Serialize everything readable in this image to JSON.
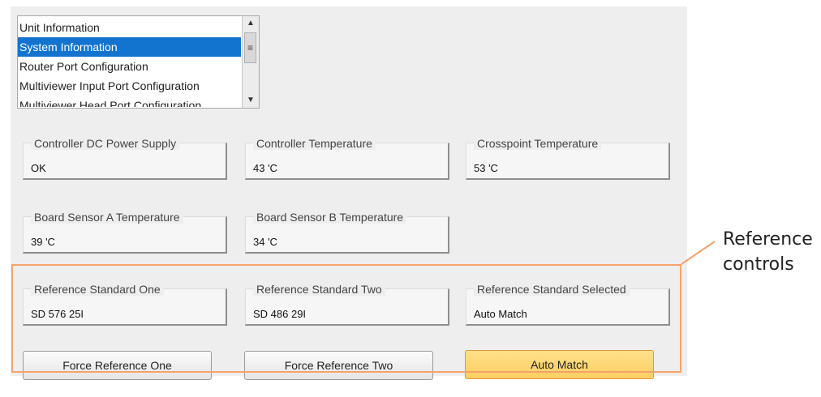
{
  "list": {
    "items": [
      {
        "label": "Unit Information",
        "selected": false
      },
      {
        "label": "System Information",
        "selected": true
      },
      {
        "label": "Router Port Configuration",
        "selected": false
      },
      {
        "label": "Multiviewer Input Port Configuration",
        "selected": false
      },
      {
        "label": "Multiviewer Head Port Configuration",
        "selected": false
      }
    ],
    "scrollbar": {
      "up_icon": "▲",
      "thumb_icon": "≡",
      "down_icon": "▼"
    }
  },
  "status": {
    "controller_dc_power_supply": {
      "label": "Controller DC Power Supply",
      "value": "OK"
    },
    "controller_temperature": {
      "label": "Controller Temperature",
      "value": "43 'C"
    },
    "crosspoint_temperature": {
      "label": "Crosspoint Temperature",
      "value": "53 'C"
    },
    "board_sensor_a_temperature": {
      "label": "Board Sensor A Temperature",
      "value": "39 'C"
    },
    "board_sensor_b_temperature": {
      "label": "Board Sensor B Temperature",
      "value": "34 'C"
    },
    "reference_standard_one": {
      "label": "Reference Standard One",
      "value": "SD 576 25I"
    },
    "reference_standard_two": {
      "label": "Reference Standard Two",
      "value": "SD 486 29I"
    },
    "reference_standard_selected": {
      "label": "Reference Standard Selected",
      "value": "Auto Match"
    }
  },
  "buttons": {
    "force_reference_one": "Force Reference One",
    "force_reference_two": "Force Reference Two",
    "auto_match": "Auto Match",
    "active_color": "#fbd270"
  },
  "callout": {
    "line1": "Reference",
    "line2": "controls",
    "color": "#f5a36a"
  }
}
